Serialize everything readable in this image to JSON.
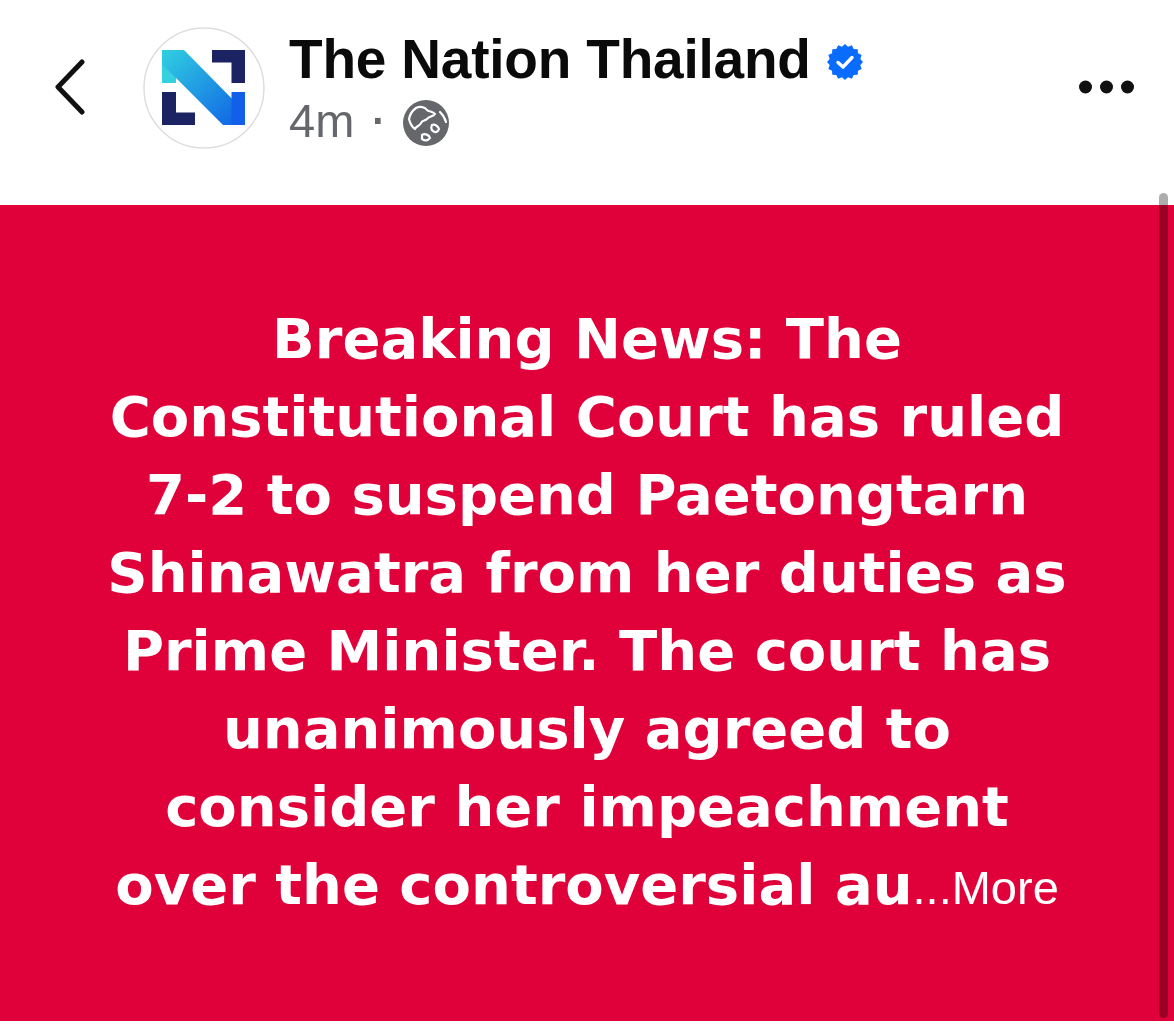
{
  "header": {
    "page_name": "The Nation Thailand",
    "verified": true,
    "time": "4m",
    "separator": "·"
  },
  "post": {
    "text": "Breaking News: The Constitutional Court has ruled 7-2 to suspend Paetongtarn Shinawatra from her duties as Prime Minister. The court has unanimously agreed to consider her impeachment over the controversial au",
    "more_link": "...More"
  }
}
